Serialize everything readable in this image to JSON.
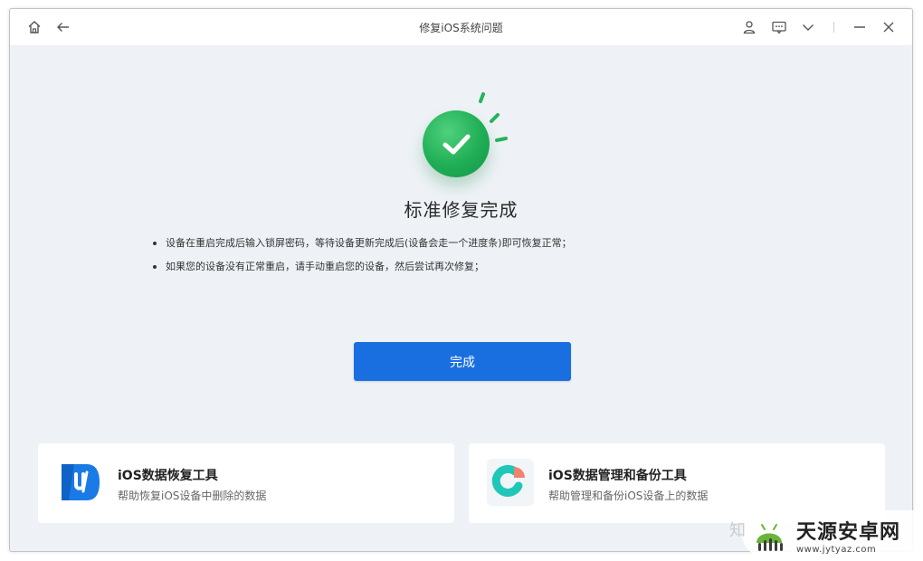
{
  "window": {
    "title": "修复iOS系统问题"
  },
  "result": {
    "heading": "标准修复完成",
    "bullets": [
      "设备在重启完成后输入锁屏密码，等待设备更新完成后(设备会走一个进度条)即可恢复正常；",
      "如果您的设备没有正常重启，请手动重启您的设备，然后尝试再次修复；"
    ],
    "done_label": "完成"
  },
  "cards": [
    {
      "title": "iOS数据恢复工具",
      "subtitle": "帮助恢复iOS设备中删除的数据",
      "icon": "ultdata-logo-icon"
    },
    {
      "title": "iOS数据管理和备份工具",
      "subtitle": "帮助管理和备份iOS设备上的数据",
      "icon": "icarefone-logo-icon"
    }
  ],
  "watermark": {
    "prefix": "知",
    "brand": "天源安卓网",
    "url": "www.jytyaz.com"
  },
  "colors": {
    "accent": "#1a6fe0",
    "success": "#1fae55",
    "background": "#eef2f6"
  }
}
